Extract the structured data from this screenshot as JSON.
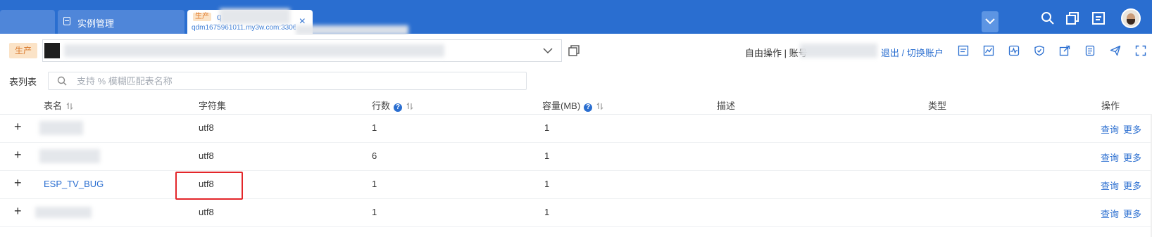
{
  "topbar": {
    "tabs": [
      {
        "label": ""
      },
      {
        "label": "实例管理"
      },
      {
        "env_tag": "生产",
        "initial": "q",
        "host": "qdm1675961011.my3w.com:3306",
        "close": "×"
      }
    ],
    "icons": [
      "chevron-down-icon",
      "search-icon",
      "copy-icon",
      "tasks-icon",
      "avatar"
    ]
  },
  "connection": {
    "env_badge": "生产",
    "free_op": "自由操作 | 账号",
    "logout": "退出 / 切换账户"
  },
  "search": {
    "label": "表列表",
    "placeholder": "支持 % 模糊匹配表名称"
  },
  "table": {
    "headers": {
      "name": "表名",
      "charset": "字符集",
      "rows": "行数",
      "capacity": "容量(MB)",
      "desc": "描述",
      "type": "类型",
      "ops": "操作"
    },
    "help_glyph": "?",
    "expand_glyph": "+",
    "rows": [
      {
        "name": "",
        "charset": "utf8",
        "rows": "1",
        "capacity": "1",
        "desc": "",
        "type": "",
        "query": "查询",
        "more": "更多"
      },
      {
        "name": "",
        "charset": "utf8",
        "rows": "6",
        "capacity": "1",
        "desc": "",
        "type": "",
        "query": "查询",
        "more": "更多"
      },
      {
        "name": "ESP_TV_BUG",
        "charset": "utf8",
        "rows": "1",
        "capacity": "1",
        "desc": "",
        "type": "",
        "query": "查询",
        "more": "更多"
      },
      {
        "name": "",
        "charset": "utf8",
        "rows": "1",
        "capacity": "1",
        "desc": "",
        "type": "",
        "query": "查询",
        "more": "更多"
      }
    ]
  },
  "colors": {
    "topbar": "#2a6ed0",
    "link": "#2a6ed0",
    "env_badge_bg": "#fbe3c7",
    "env_badge_text": "#d9782b",
    "highlight": "#e3262a"
  }
}
